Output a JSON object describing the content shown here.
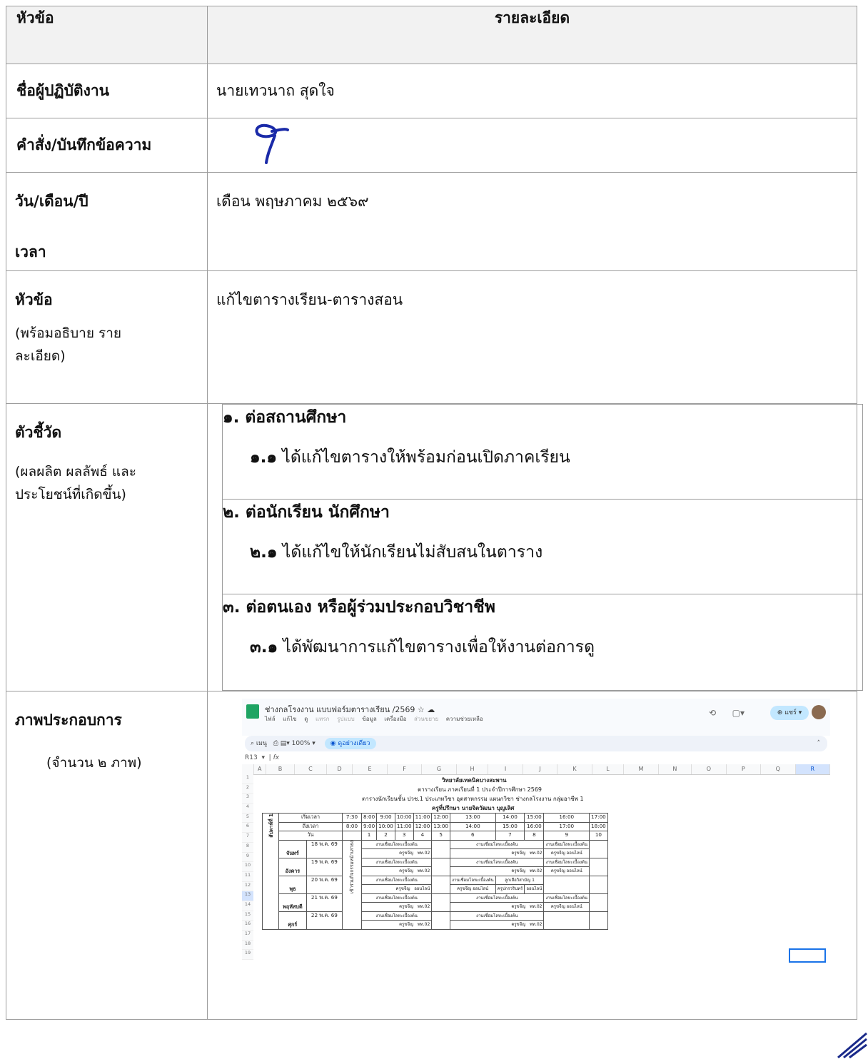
{
  "header": {
    "col_topic": "หัวข้อ",
    "col_detail": "รายละเอียด"
  },
  "rows": {
    "performer": {
      "label": "ชื่อผู้ปฏิบัติงาน",
      "value": "นายเทวนาถ สุดใจ"
    },
    "order": {
      "label": "คำสั่ง/บันทึกข้อความ"
    },
    "date": {
      "label": "วัน/เดือน/ปี",
      "label2": "เวลา",
      "value": "เดือน พฤษภาคม ๒๕๖๙"
    },
    "topic": {
      "label": "หัวข้อ",
      "sublabel": "(พร้อมอธิบาย รายละเอียด)",
      "value": "แก้ไขตารางเรียน-ตารางสอน"
    },
    "indicators": {
      "label": "ตัวชี้วัด",
      "sublabel": "(ผลผลิต ผลลัพธ์ และประโยชน์ที่เกิดขึ้น)",
      "items": [
        {
          "title": "๑. ต่อสถานศึกษา",
          "sub_num": "๑.๑",
          "sub_text": " ได้แก้ไขตารางให้พร้อมก่อนเปิดภาคเรียน"
        },
        {
          "title": "๒. ต่อนักเรียน นักศึกษา",
          "sub_num": "๒.๑",
          "sub_text": " ได้แก้ไขให้นักเรียนไม่สับสนในตาราง"
        },
        {
          "title": "๓. ต่อตนเอง หรือผู้ร่วมประกอบวิชาชีพ",
          "sub_num": "๓.๑",
          "sub_text": " ได้พัฒนาการแก้ไขตารางเพื่อให้งานต่อการดู"
        }
      ]
    },
    "images": {
      "label": "ภาพประกอบการ",
      "sublabel": "(จำนวน ๒ ภาพ)"
    }
  },
  "screenshot": {
    "doc_title": "ช่างกลโรงงาน แบบฟอร์มตารางเรียน /2569",
    "menu": [
      "ไฟล์",
      "แก้ไข",
      "ดู",
      "แทรก",
      "รูปแบบ",
      "ข้อมูล",
      "เครื่องมือ",
      "ส่วนขยาย",
      "ความช่วยเหลือ"
    ],
    "share_label": "แชร์",
    "search_label": "เมนู",
    "zoom": "100%",
    "mode_label": "ดูอย่างเดียว",
    "cell_ref": "R13",
    "fx": "fx",
    "columns": [
      "A",
      "B",
      "C",
      "D",
      "E",
      "F",
      "G",
      "H",
      "I",
      "J",
      "K",
      "L",
      "M",
      "N",
      "O",
      "P",
      "Q",
      "R"
    ],
    "rows_nums": [
      "1",
      "2",
      "3",
      "4",
      "5",
      "6",
      "7",
      "8",
      "9",
      "10",
      "11",
      "12",
      "13",
      "14",
      "15",
      "16",
      "17",
      "18",
      "19"
    ],
    "title1": "วิทยาลัยเทคนิคบางสะพาน",
    "title2": "ตารางเรียน ภาคเรียนที่ 1 ประจำปีการศึกษา 2569",
    "title3": "ตารางนักเรียนชั้น ปวช.1 ประเภทวิชา อุตสาหกรรม แผนกวิชา ช่างกลโรงงาน กลุ่มอาชีพ 1",
    "title4": "ครูที่ปรึกษา นายจิตวัฒนา บุญเลิศ",
    "start_label": "เริ่มเวลา",
    "end_label": "ถึงเวลา",
    "day_label": "วัน",
    "start_times": [
      "7:30",
      "8:00",
      "9:00",
      "10:00",
      "11:00",
      "12:00",
      "13:00",
      "14:00",
      "15:00",
      "16:00",
      "17:00"
    ],
    "end_times": [
      "8:00",
      "9:00",
      "10:00",
      "11:00",
      "12:00",
      "13:00",
      "14:00",
      "15:00",
      "16:00",
      "17:00",
      "18:00"
    ],
    "periods": [
      "1",
      "2",
      "3",
      "4",
      "5",
      "6",
      "7",
      "8",
      "9",
      "10"
    ],
    "week_label": "สัปดาห์ที่ 1",
    "activity_label": "เข้าร่วมกิจกรรมหน้าเสาธง",
    "days": [
      {
        "day": "จันทร์",
        "date": "18 พ.ค. 69"
      },
      {
        "day": "อังคาร",
        "date": "19 พ.ค. 69"
      },
      {
        "day": "พุธ",
        "date": "20 พ.ค. 69"
      },
      {
        "day": "พฤหัสบดี",
        "date": "21 พ.ค. 69"
      },
      {
        "day": "ศุกร์",
        "date": "22 พ.ค. 69"
      }
    ],
    "subject": "งานเชื่อมโลหะเบื้องต้น",
    "teacher": "ครูขจีญ",
    "room": "พท.02",
    "online": "ออนไลน์",
    "sub9": "งานเชื่อมโลหะเบื้องต้น",
    "sub9b": "ครูขจีญ ออนไลน์",
    "wed_a": "ลูกเสือวิสามัญ 1",
    "wed_b": "ครูปกรวรินทร์",
    "wed_online": "ออนไลน์"
  }
}
